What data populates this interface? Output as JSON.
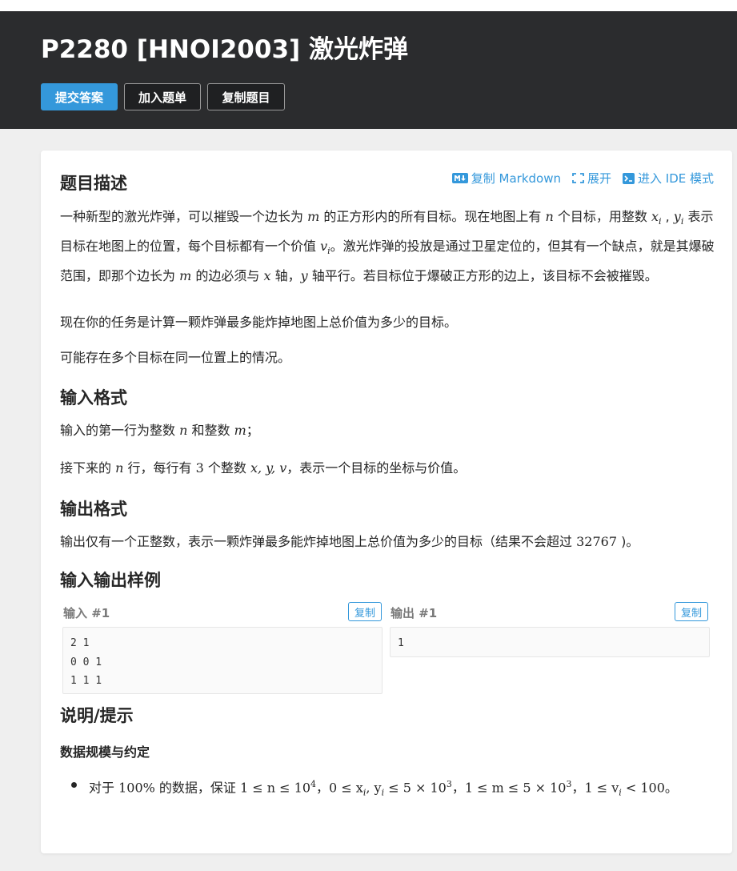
{
  "problem": {
    "title": "P2280 [HNOI2003] 激光炸弹"
  },
  "actions": {
    "submit": "提交答案",
    "add_to_list": "加入题单",
    "copy_problem": "复制题目"
  },
  "toolbar": {
    "copy_markdown": "复制 Markdown",
    "expand": "展开",
    "ide_mode": "进入 IDE 模式"
  },
  "description": {
    "heading": "题目描述",
    "p1_a": "一种新型的激光炸弹，可以摧毁一个边长为 ",
    "p1_m": "m",
    "p1_b": " 的正方形内的所有目标。现在地图上有 ",
    "p1_n": "n",
    "p1_c": " 个目标，用整数 ",
    "p1_x": "x",
    "p1_i1": "i",
    "p1_comma": " , ",
    "p1_y": "y",
    "p1_i2": "i",
    "p1_d": " 表示目标在地图上的位置，每个目标都有一个价值 ",
    "p1_v": "v",
    "p1_i3": "i",
    "p1_e": "。激光炸弹的投放是通过卫星定位的，但其有一个缺点，就是其爆破范围，即那个边长为 ",
    "p1_m2": "m",
    "p1_f": " 的边必须与 ",
    "p1_xaxis": "x",
    "p1_g": " 轴，",
    "p1_yaxis": "y",
    "p1_h": " 轴平行。若目标位于爆破正方形的边上，该目标不会被摧毁。",
    "p2": "现在你的任务是计算一颗炸弹最多能炸掉地图上总价值为多少的目标。",
    "p3": "可能存在多个目标在同一位置上的情况。"
  },
  "input_format": {
    "heading": "输入格式",
    "l1_a": "输入的第一行为整数 ",
    "l1_n": "n",
    "l1_b": " 和整数 ",
    "l1_m": "m",
    "l1_c": "；",
    "l2_a": "接下来的 ",
    "l2_n": "n",
    "l2_b": " 行，每行有 ",
    "l2_3": "3",
    "l2_c": " 个整数 ",
    "l2_xyv": "x, y, v",
    "l2_d": "，表示一个目标的坐标与价值。"
  },
  "output_format": {
    "heading": "输出格式",
    "l1_a": "输出仅有一个正整数，表示一颗炸弹最多能炸掉地图上总价值为多少的目标（结果不会超过 ",
    "l1_num": "32767",
    "l1_b": " )。"
  },
  "samples": {
    "heading": "输入输出样例",
    "input_label": "输入 #1",
    "output_label": "输出 #1",
    "copy": "复制",
    "input": "2 1\n0 0 1\n1 1 1",
    "output": "1"
  },
  "hint": {
    "heading": "说明/提示",
    "sub_heading": "数据规模与约定",
    "item_a": "对于 ",
    "item_pct": "100%",
    "item_b": " 的数据，保证 ",
    "c1": "1 ≤ n ≤ 10",
    "c1_sup": "4",
    "sep1": "，",
    "c2": "0 ≤ x",
    "c2_sub1": "i",
    "c2_mid": ", y",
    "c2_sub2": "i",
    "c2_end": " ≤ 5 × 10",
    "c2_sup": "3",
    "sep2": "，",
    "c3": "1 ≤ m ≤ 5 × 10",
    "c3_sup": "3",
    "sep3": "，",
    "c4": "1 ≤ v",
    "c4_sub": "i",
    "c4_end": " < 100",
    "end": "。"
  },
  "colors": {
    "header_bg": "#2b2c2e",
    "accent": "#3498db",
    "page_bg": "#efefef"
  }
}
